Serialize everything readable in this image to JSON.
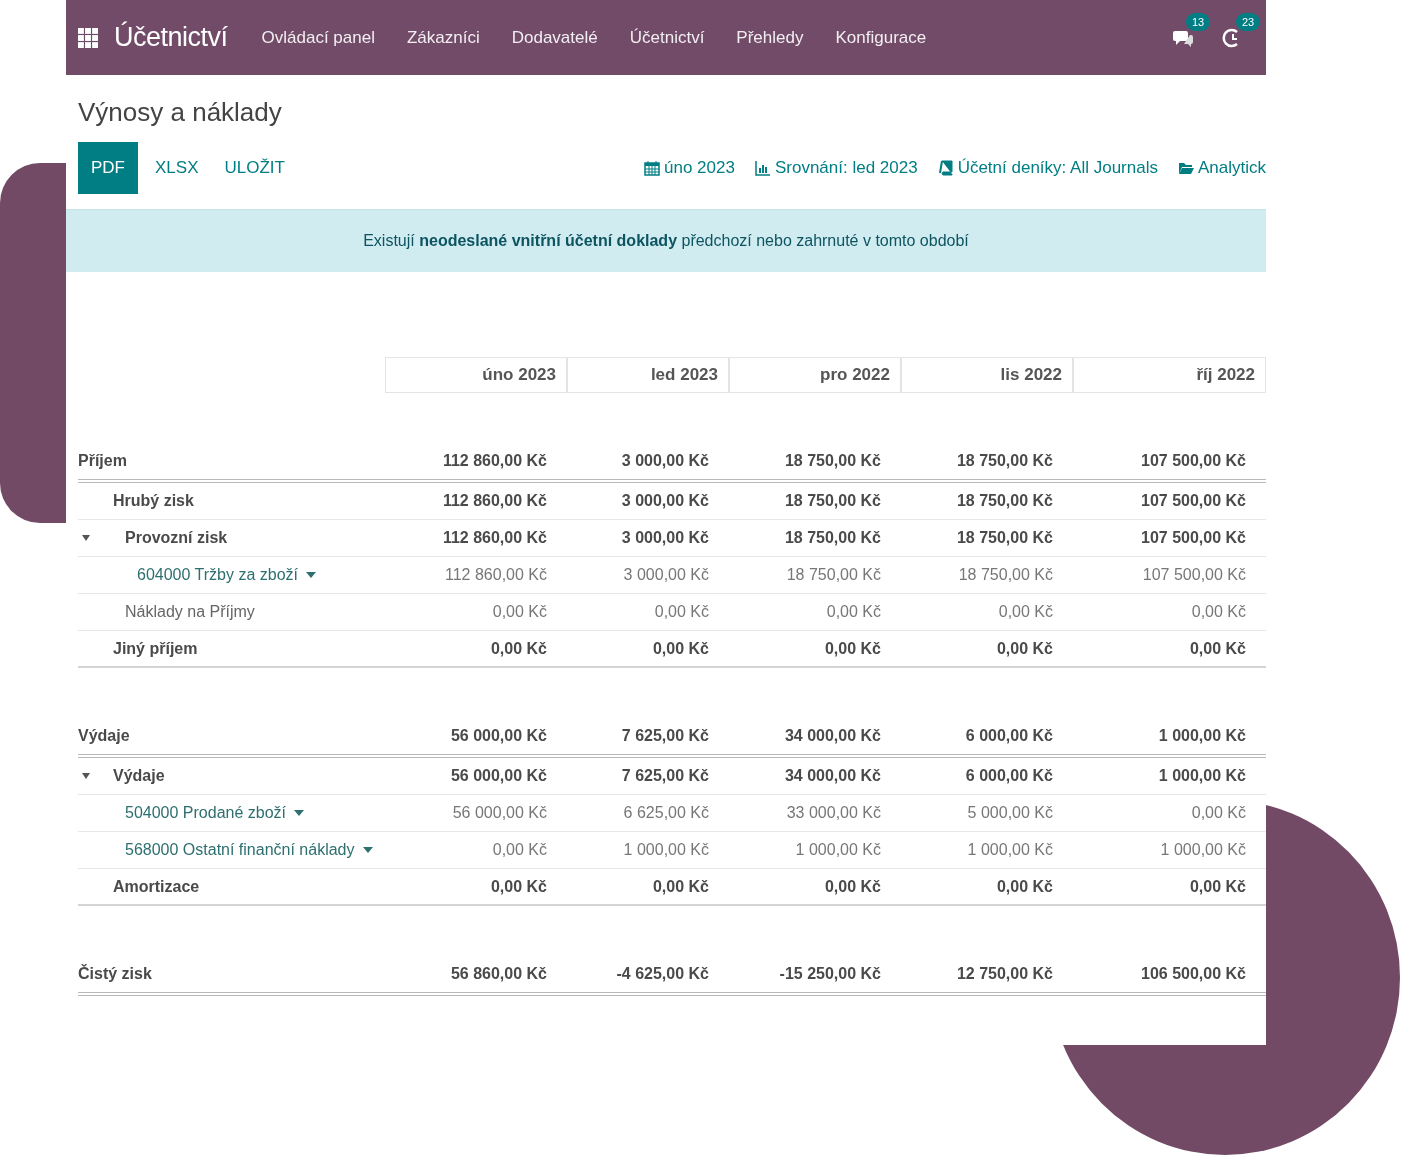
{
  "navbar": {
    "app_title": "Účetnictví",
    "menu": [
      "Ovládací panel",
      "Zákazníci",
      "Dodavatelé",
      "Účetnictví",
      "Přehledy",
      "Konfigurace"
    ],
    "messages_count": "13",
    "activities_count": "23"
  },
  "page_title": "Výnosy a náklady",
  "toolbar": {
    "buttons": [
      {
        "label": "PDF",
        "kind": "primary"
      },
      {
        "label": "XLSX",
        "kind": "link"
      },
      {
        "label": "ULOŽIT",
        "kind": "link"
      }
    ],
    "filters": [
      {
        "label": "úno 2023",
        "kind": "calendar"
      },
      {
        "label": "Srovnání: led 2023",
        "kind": "chart"
      },
      {
        "label": "Účetní deníky: All Journals",
        "kind": "book"
      },
      {
        "label": "Analytick",
        "kind": "folder"
      }
    ]
  },
  "alert": "Existují **neodeslané vnitřní účetní doklady** předchozí nebo zahrnuté v tomto období",
  "table": {
    "columns": [
      "úno 2023",
      "led 2023",
      "pro 2022",
      "lis 2022",
      "říj 2022"
    ],
    "sections": [
      {
        "label": "Příjem",
        "kind": "section",
        "values": [
          "112 860,00 Kč",
          "3 000,00 Kč",
          "18 750,00 Kč",
          "18 750,00 Kč",
          "107 500,00 Kč"
        ],
        "children": [
          {
            "label": "Hrubý zisk",
            "kind": "total",
            "values": [
              "112 860,00 Kč",
              "3 000,00 Kč",
              "18 750,00 Kč",
              "18 750,00 Kč",
              "107 500,00 Kč"
            ],
            "children": [
              {
                "label": "Provozní zisk",
                "kind": "total",
                "expanded": true,
                "values": [
                  "112 860,00 Kč",
                  "3 000,00 Kč",
                  "18 750,00 Kč",
                  "18 750,00 Kč",
                  "107 500,00 Kč"
                ],
                "children": [
                  {
                    "label": "604000 Tržby za zboží",
                    "kind": "account",
                    "values": [
                      "112 860,00 Kč",
                      "3 000,00 Kč",
                      "18 750,00 Kč",
                      "18 750,00 Kč",
                      "107 500,00 Kč"
                    ]
                  }
                ]
              },
              {
                "label": "Náklady na Příjmy",
                "kind": "plain",
                "values": [
                  "0,00 Kč",
                  "0,00 Kč",
                  "0,00 Kč",
                  "0,00 Kč",
                  "0,00 Kč"
                ]
              }
            ]
          },
          {
            "label": "Jiný příjem",
            "kind": "total",
            "values": [
              "0,00 Kč",
              "0,00 Kč",
              "0,00 Kč",
              "0,00 Kč",
              "0,00 Kč"
            ]
          }
        ]
      },
      {
        "label": "Výdaje",
        "kind": "section",
        "values": [
          "56 000,00 Kč",
          "7 625,00 Kč",
          "34 000,00 Kč",
          "6 000,00 Kč",
          "1 000,00 Kč"
        ],
        "children": [
          {
            "label": "Výdaje",
            "kind": "total",
            "expanded": true,
            "values": [
              "56 000,00 Kč",
              "7 625,00 Kč",
              "34 000,00 Kč",
              "6 000,00 Kč",
              "1 000,00 Kč"
            ],
            "children": [
              {
                "label": "504000 Prodané zboží",
                "kind": "account",
                "values": [
                  "56 000,00 Kč",
                  "6 625,00 Kč",
                  "33 000,00 Kč",
                  "5 000,00 Kč",
                  "0,00 Kč"
                ]
              },
              {
                "label": "568000 Ostatní finanční náklady",
                "kind": "account",
                "values": [
                  "0,00 Kč",
                  "1 000,00 Kč",
                  "1 000,00 Kč",
                  "1 000,00 Kč",
                  "1 000,00 Kč"
                ]
              }
            ]
          },
          {
            "label": "Amortizace",
            "kind": "total",
            "values": [
              "0,00 Kč",
              "0,00 Kč",
              "0,00 Kč",
              "0,00 Kč",
              "0,00 Kč"
            ]
          }
        ]
      },
      {
        "label": "Čistý zisk",
        "kind": "section",
        "values": [
          "56 860,00 Kč",
          "-4 625,00 Kč",
          "-15 250,00 Kč",
          "12 750,00 Kč",
          "106 500,00 Kč"
        ]
      }
    ]
  }
}
